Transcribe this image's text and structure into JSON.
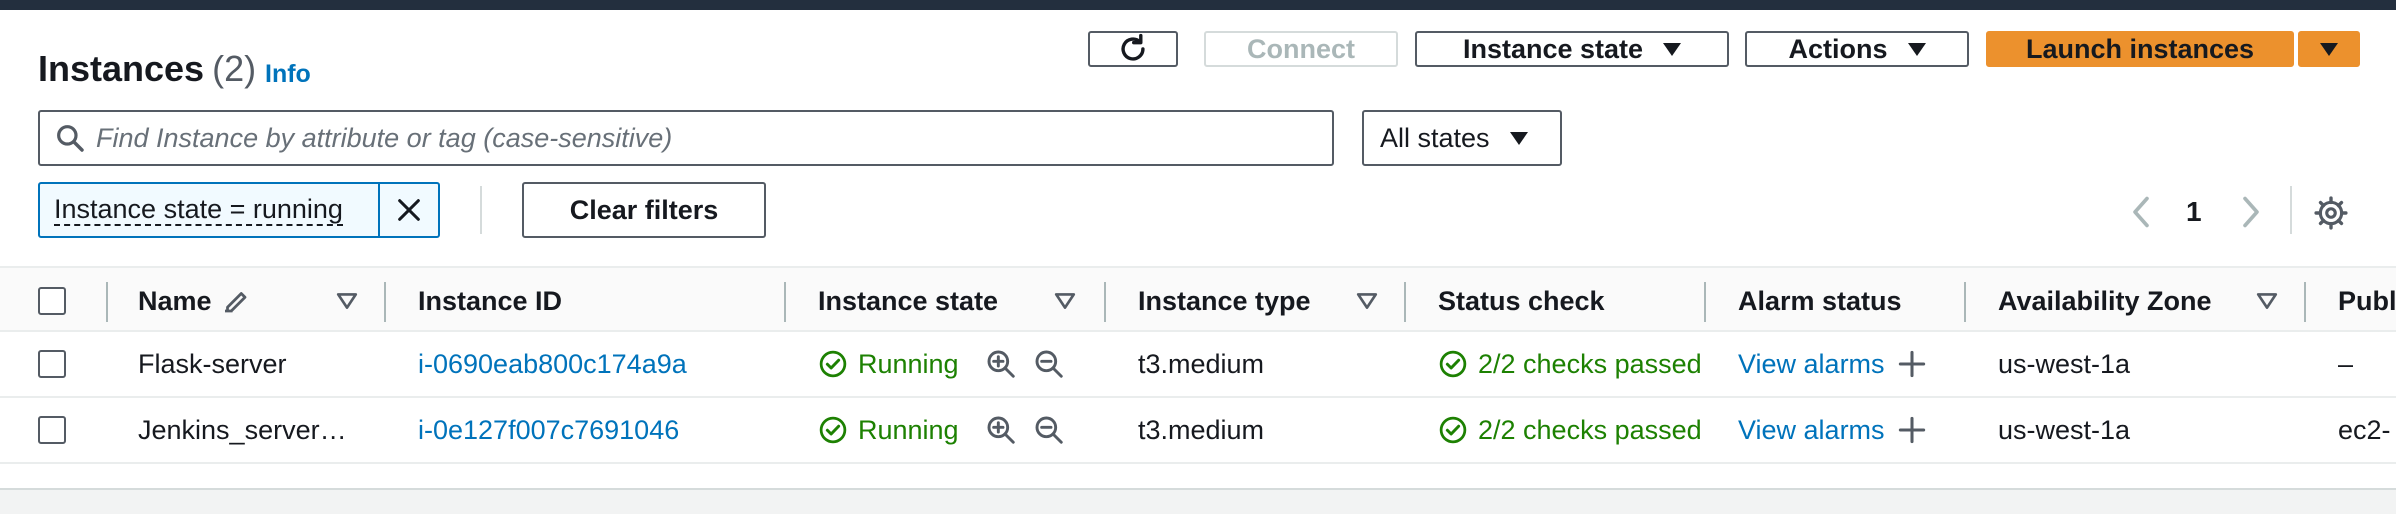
{
  "header": {
    "title": "Instances",
    "count": "(2)",
    "info": "Info"
  },
  "toolbar": {
    "refresh_icon": "refresh-icon",
    "connect": "Connect",
    "instance_state": "Instance state",
    "actions": "Actions",
    "launch": "Launch instances"
  },
  "search": {
    "placeholder": "Find Instance by attribute or tag (case-sensitive)",
    "states_select": "All states"
  },
  "filters": {
    "token": "Instance state = running",
    "clear": "Clear filters"
  },
  "pagination": {
    "page": "1"
  },
  "table": {
    "columns": {
      "name": "Name",
      "instance_id": "Instance ID",
      "instance_state": "Instance state",
      "instance_type": "Instance type",
      "status_check": "Status check",
      "alarm_status": "Alarm status",
      "availability_zone": "Availability Zone",
      "public": "Publ"
    },
    "rows": [
      {
        "name": "Flask-server",
        "instance_id": "i-0690eab800c174a9a",
        "state": "Running",
        "type": "t3.medium",
        "status_check": "2/2 checks passed",
        "alarm": "View alarms",
        "zone": "us-west-1a",
        "public": "–"
      },
      {
        "name": "Jenkins_server…",
        "instance_id": "i-0e127f007c7691046",
        "state": "Running",
        "type": "t3.medium",
        "status_check": "2/2 checks passed",
        "alarm": "View alarms",
        "zone": "us-west-1a",
        "public": "ec2-"
      }
    ]
  },
  "colors": {
    "accent": "#0073bb",
    "primary": "#ec912d",
    "success": "#1d8102",
    "header_bar": "#232f3e"
  }
}
